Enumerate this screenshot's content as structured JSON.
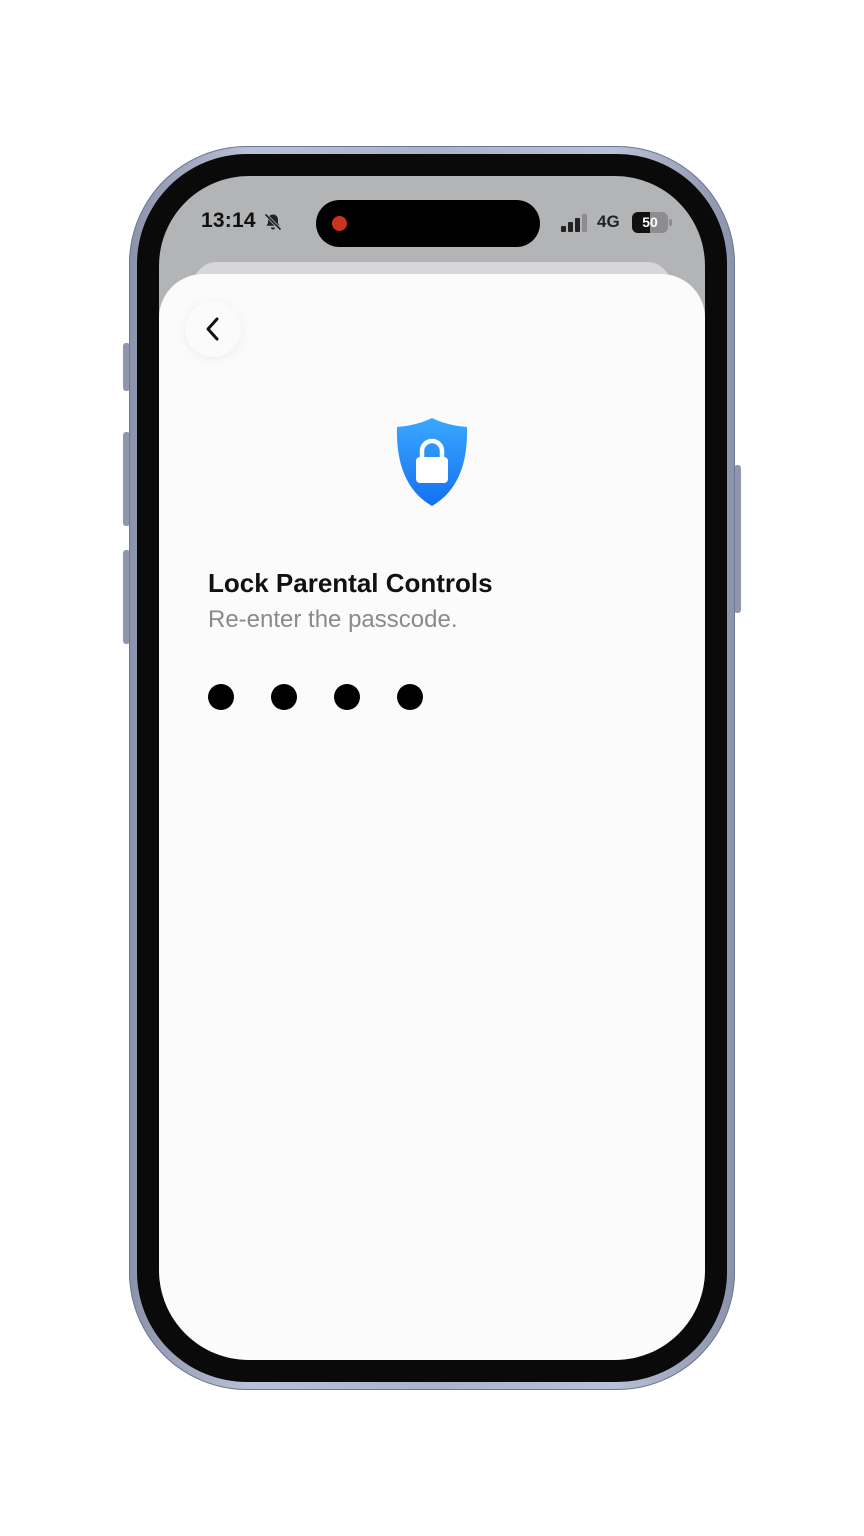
{
  "status_bar": {
    "time": "13:14",
    "network": "4G",
    "battery_percent": "50",
    "battery_level": 0.5
  },
  "icons": {
    "silent": "bell-slash-icon",
    "back": "chevron-left-icon",
    "lock": "shield-lock-icon",
    "signal": "signal-bars-icon"
  },
  "colors": {
    "accent": "#1e90ff",
    "recording": "#c8351f"
  },
  "screen": {
    "title": "Lock Parental Controls",
    "subtitle": "Re-enter the passcode.",
    "passcode_digits_entered": 4
  }
}
